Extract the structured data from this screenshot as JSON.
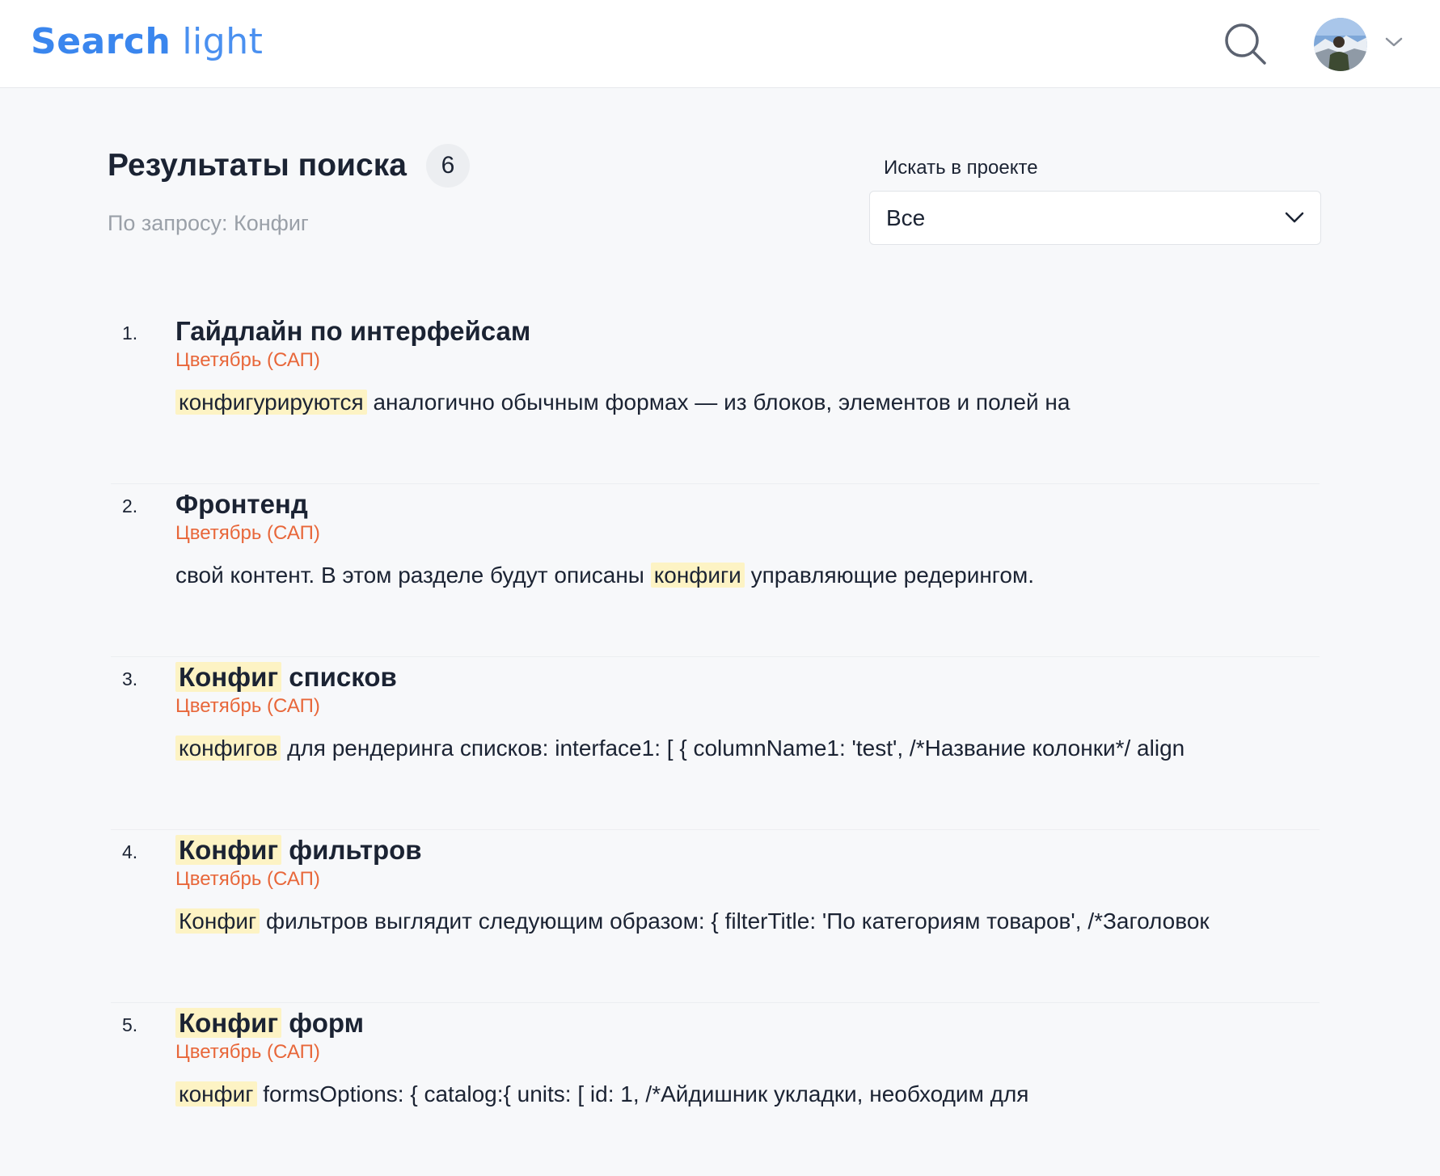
{
  "header": {
    "logo_bold": "Search",
    "logo_light": "light",
    "search_icon": "search-icon",
    "avatar_icon": "avatar",
    "chevron_icon": "chevron-down-icon"
  },
  "main": {
    "title": "Результаты поиска",
    "count": "6",
    "query_text": "По запросу: Конфиг"
  },
  "filter": {
    "label": "Искать в проекте",
    "selected": "Все"
  },
  "results": [
    {
      "number": "1.",
      "title_hl": "",
      "title_rest": "Гайдлайн по интерфейсам",
      "project": "Цветябрь (САП)",
      "snippet_pre": "",
      "snippet_hl": "конфигурируются",
      "snippet_post": " аналогично обычным формах — из блоков, элементов и полей на"
    },
    {
      "number": "2.",
      "title_hl": "",
      "title_rest": "Фронтенд",
      "project": "Цветябрь (САП)",
      "snippet_pre": "свой контент. В этом разделе будут описаны ",
      "snippet_hl": "конфиги",
      "snippet_post": " управляющие редерингом."
    },
    {
      "number": "3.",
      "title_hl": "Конфиг",
      "title_rest": " списков",
      "project": "Цветябрь (САП)",
      "snippet_pre": "",
      "snippet_hl": "конфигов",
      "snippet_post": " для рендеринга списков: interface1: [ { columnName1: 'test', /*Название колонки*/ align"
    },
    {
      "number": "4.",
      "title_hl": "Конфиг",
      "title_rest": " фильтров",
      "project": "Цветябрь (САП)",
      "snippet_pre": "",
      "snippet_hl": "Конфиг",
      "snippet_post": " фильтров выглядит следующим образом: { filterTitle: 'По категориям товаров', /*Заголовок"
    },
    {
      "number": "5.",
      "title_hl": "Конфиг",
      "title_rest": " форм",
      "project": "Цветябрь (САП)",
      "snippet_pre": "",
      "snippet_hl": "конфиг",
      "snippet_post": " formsOptions: { catalog:{ units: [ id: 1, /*Айдишник укладки, необходим для"
    }
  ],
  "colors": {
    "brand": "#3a86ee",
    "project": "#e8673a",
    "highlight": "#fdf3c4",
    "text": "#1b2333"
  }
}
